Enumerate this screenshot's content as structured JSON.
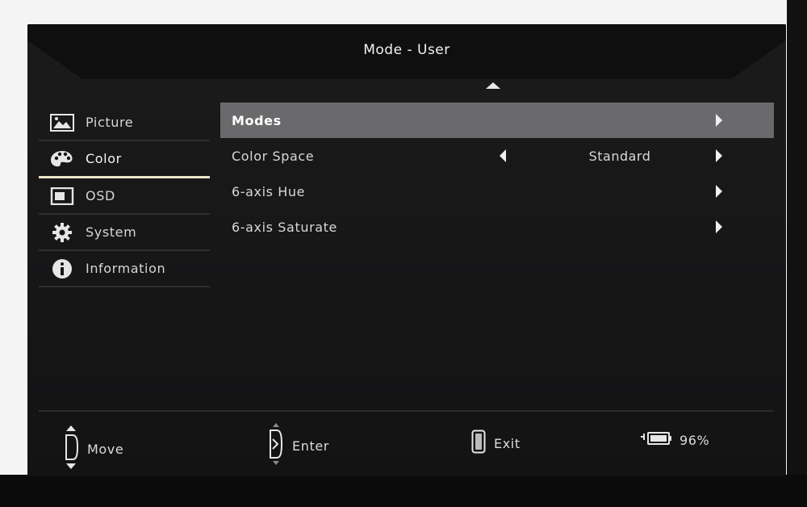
{
  "header": {
    "title": "Mode - User"
  },
  "sidebar": {
    "items": [
      {
        "label": "Picture",
        "icon": "picture-icon",
        "active": false
      },
      {
        "label": "Color",
        "icon": "palette-icon",
        "active": true
      },
      {
        "label": "OSD",
        "icon": "osd-icon",
        "active": false
      },
      {
        "label": "System",
        "icon": "gear-icon",
        "active": false
      },
      {
        "label": "Information",
        "icon": "info-icon",
        "active": false
      }
    ]
  },
  "main": {
    "rows": [
      {
        "label": "Modes",
        "value": "",
        "selected": true
      },
      {
        "label": "Color Space",
        "value": "Standard",
        "selected": false
      },
      {
        "label": "6-axis Hue",
        "value": "",
        "selected": false
      },
      {
        "label": "6-axis Saturate",
        "value": "",
        "selected": false
      }
    ]
  },
  "footer": {
    "move": "Move",
    "enter": "Enter",
    "exit": "Exit",
    "battery": "96%"
  },
  "colors": {
    "accent_underline": "#ece6c8",
    "selected_row": "#6a6a6c",
    "osd_background": "#151516"
  }
}
